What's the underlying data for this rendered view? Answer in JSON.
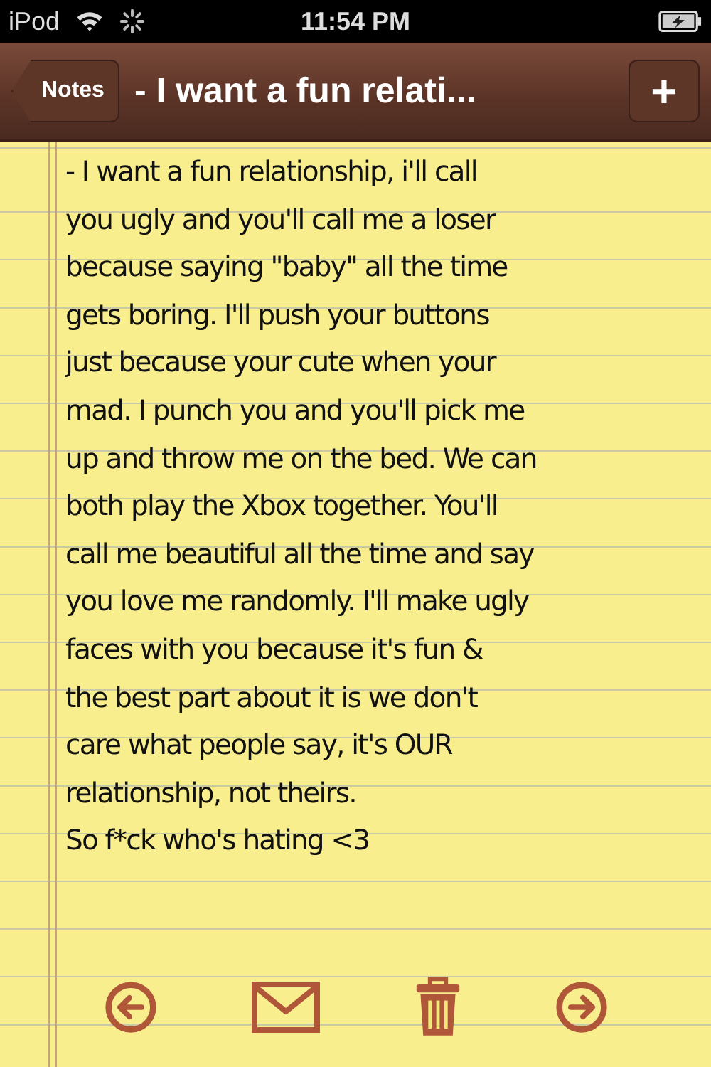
{
  "status_bar": {
    "carrier": "iPod",
    "time": "11:54 PM"
  },
  "nav_bar": {
    "back_button": "Notes",
    "title": "- I want a fun relati...",
    "add_button": "+"
  },
  "note": {
    "lines": [
      "- I want a fun relationship, i'll call",
      "you ugly and you'll call me a loser",
      "because saying \"baby\" all the time",
      "gets boring. I'll push your buttons",
      "just because your cute when your",
      "mad. I punch you and you'll pick me",
      "up and throw me on the bed. We can",
      "both play the Xbox together. You'll",
      "call me beautiful all the time and say",
      "you love me randomly. I'll make ugly",
      "faces with you because it's fun &",
      "the best part about it is we don't",
      "care what people say, it's OUR",
      "relationship, not theirs.",
      "So f*ck who's hating <3"
    ]
  },
  "toolbar": [
    {
      "kind": "previous"
    },
    {
      "kind": "mail"
    },
    {
      "kind": "trash"
    },
    {
      "kind": "next"
    }
  ]
}
